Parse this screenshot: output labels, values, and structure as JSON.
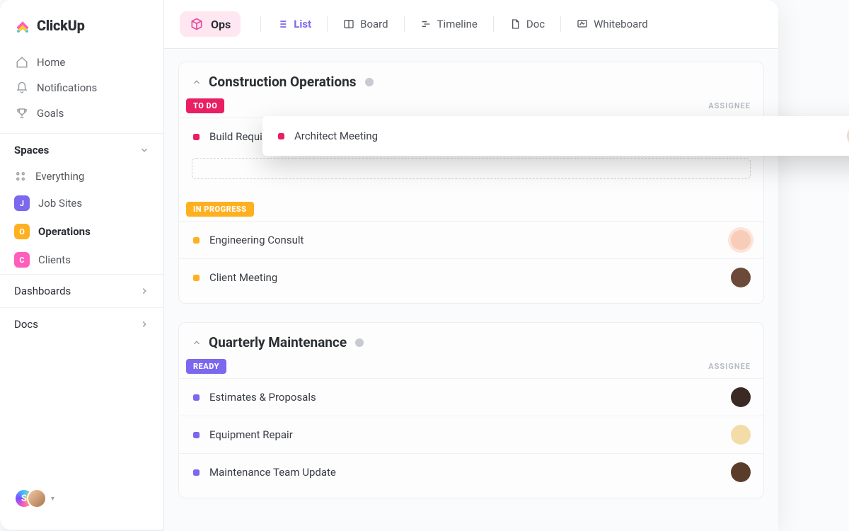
{
  "brand": {
    "name": "ClickUp"
  },
  "sidebar": {
    "nav": [
      {
        "label": "Home"
      },
      {
        "label": "Notifications"
      },
      {
        "label": "Goals"
      }
    ],
    "spaces_header": "Spaces",
    "spaces": [
      {
        "label": "Everything",
        "badge": null
      },
      {
        "label": "Job Sites",
        "badge": "J",
        "color": "#7b68ee"
      },
      {
        "label": "Operations",
        "badge": "O",
        "color": "#ffb020",
        "active": true
      },
      {
        "label": "Clients",
        "badge": "C",
        "color": "#ff5ebc"
      }
    ],
    "sections": [
      {
        "label": "Dashboards"
      },
      {
        "label": "Docs"
      }
    ],
    "footer_initial": "S"
  },
  "topbar": {
    "page": "Ops",
    "views": [
      {
        "label": "List",
        "active": true
      },
      {
        "label": "Board"
      },
      {
        "label": "Timeline"
      },
      {
        "label": "Doc"
      },
      {
        "label": "Whiteboard"
      }
    ]
  },
  "panels": [
    {
      "title": "Construction Operations",
      "groups": [
        {
          "status": "TO DO",
          "status_color": "#e91e63",
          "assignee_header": "ASSIGNEE",
          "tasks": [
            {
              "name": "Build Requirements",
              "dot": "#e91e63",
              "avatar": "#f0d9b5"
            }
          ],
          "dragging_task": {
            "name": "Architect Meeting",
            "dot": "#e91e63",
            "avatar": "#f3d6c9"
          },
          "dropzone": true
        },
        {
          "status": "IN PROGRESS",
          "status_color": "#ffb020",
          "tasks": [
            {
              "name": "Engineering Consult",
              "dot": "#ffb020",
              "avatar": "#f8cdb8"
            },
            {
              "name": "Client Meeting",
              "dot": "#ffb020",
              "avatar": "#6b4a3a"
            }
          ]
        }
      ]
    },
    {
      "title": "Quarterly Maintenance",
      "groups": [
        {
          "status": "READY",
          "status_color": "#7b68ee",
          "assignee_header": "ASSIGNEE",
          "tasks": [
            {
              "name": "Estimates & Proposals",
              "dot": "#7b68ee",
              "avatar": "#3b2a23"
            },
            {
              "name": "Equipment Repair",
              "dot": "#7b68ee",
              "avatar": "#f3dca8"
            },
            {
              "name": "Maintenance Team Update",
              "dot": "#7b68ee",
              "avatar": "#5a3c2a"
            }
          ]
        }
      ]
    }
  ]
}
